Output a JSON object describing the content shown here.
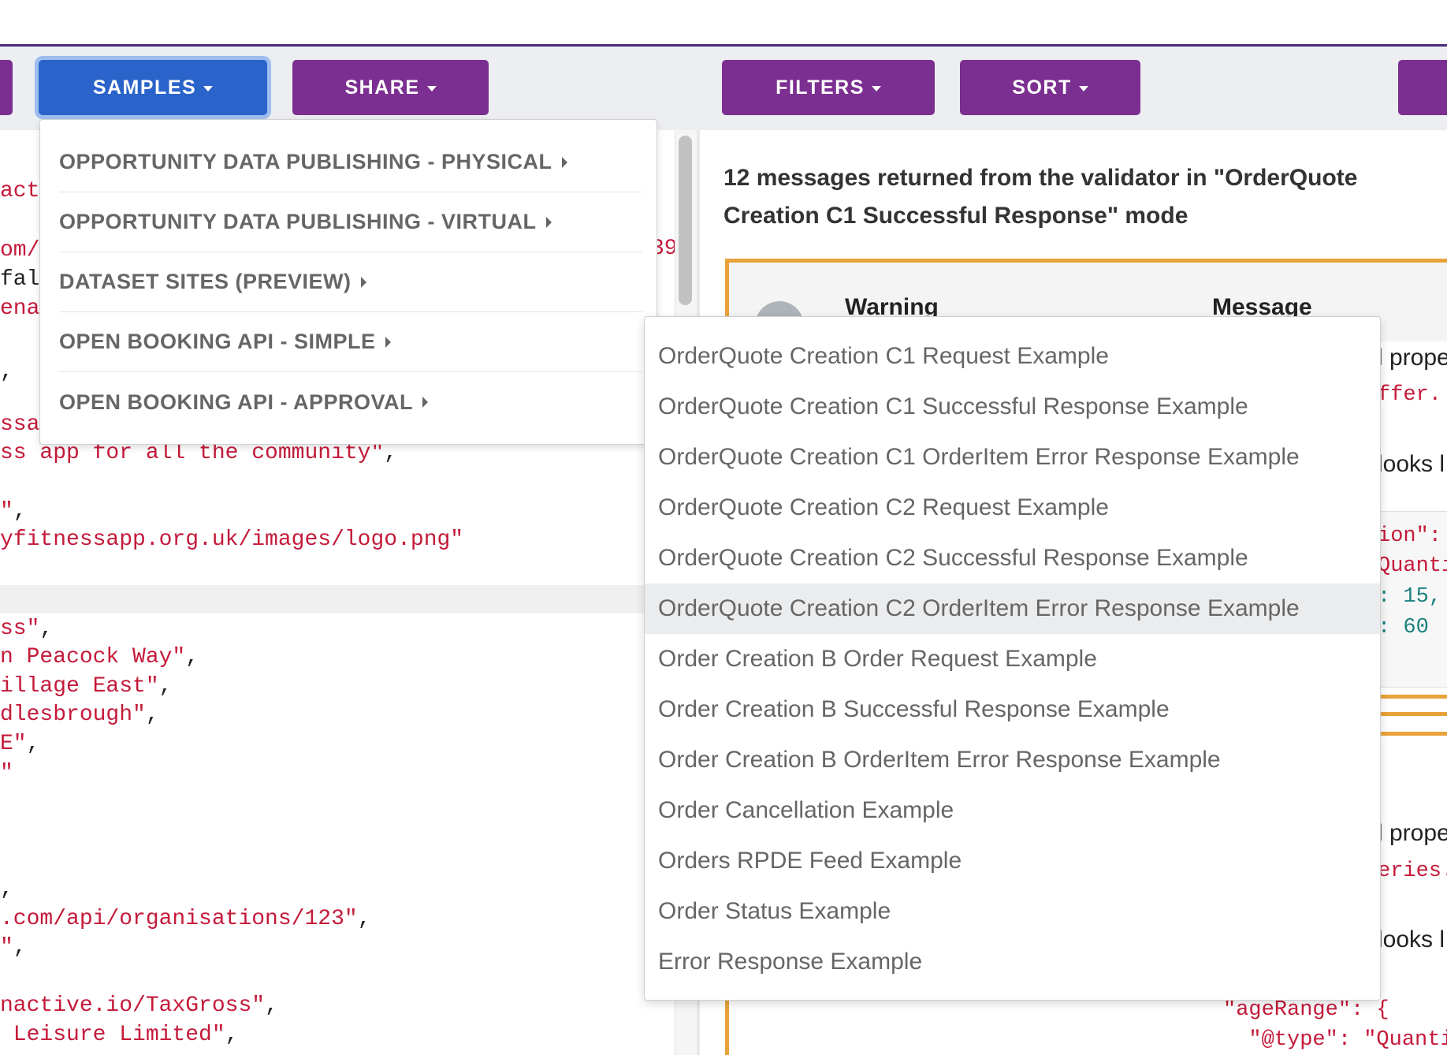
{
  "toolbar": {
    "buttons": [
      "SAMPLES",
      "SHARE",
      "FILTERS",
      "SORT"
    ]
  },
  "editor": {
    "lines": [
      {
        "t": "act",
        "p": ""
      },
      {
        "t": "om/",
        "p": ""
      },
      {
        "t": "",
        "p": "fals"
      },
      {
        "t": "enac",
        "p": ""
      },
      {
        "t": "",
        "p": ","
      },
      {
        "t": "ssap",
        "p": ""
      },
      {
        "t": "ss app for all the community\"",
        "p": ","
      },
      {
        "t": "\"",
        "p": ","
      },
      {
        "t": "yfitnessapp.org.uk/images/logo.png\"",
        "p": ""
      },
      {
        "t": "ss\"",
        "p": ","
      },
      {
        "t": "n Peacock Way\"",
        "p": ","
      },
      {
        "t": "illage East\"",
        "p": ","
      },
      {
        "t": "dlesbrough\"",
        "p": ","
      },
      {
        "t": "E\"",
        "p": ","
      },
      {
        "t": "\"",
        "p": ""
      },
      {
        "t": "",
        "p": ","
      },
      {
        "t": ".com/api/organisations/123\"",
        "p": ","
      },
      {
        "t": "\"",
        "p": ","
      },
      {
        "t": "nactive.io/TaxGross\"",
        "p": ","
      },
      {
        "t": " Leisure Limited\"",
        "p": ","
      }
    ],
    "stray_digit": "39"
  },
  "results": {
    "title": "12 messages returned from the validator in \"OrderQuote Creation C1 Successful Response\" mode",
    "col_warning": "Warning",
    "col_message": "Message",
    "msg1_prop": "l prope",
    "msg1_code": "ffer.",
    "msg1_looks": "looks l",
    "code1_a": "ion\":",
    "code1_b": "Quanti",
    "code1_c": ": 15,",
    "code1_d": ": 60",
    "msg2_prop": "l prope",
    "msg2_code": "eries.",
    "msg2_looks": "looks l",
    "code2_a": "\"ageRange\": {",
    "code2_b": "  \"@type\": \"Quanti"
  },
  "samples_menu": {
    "categories": [
      "OPPORTUNITY DATA PUBLISHING - PHYSICAL",
      "OPPORTUNITY DATA PUBLISHING - VIRTUAL",
      "DATASET SITES (PREVIEW)",
      "OPEN BOOKING API - SIMPLE",
      "OPEN BOOKING API - APPROVAL"
    ],
    "submenu": [
      "OrderQuote Creation C1 Request Example",
      "OrderQuote Creation C1 Successful Response Example",
      "OrderQuote Creation C1 OrderItem Error Response Example",
      "OrderQuote Creation C2 Request Example",
      "OrderQuote Creation C2 Successful Response Example",
      "OrderQuote Creation C2 OrderItem Error Response Example",
      "Order Creation B Order Request Example",
      "Order Creation B Successful Response Example",
      "Order Creation B OrderItem Error Response Example",
      "Order Cancellation Example",
      "Orders RPDE Feed Example",
      "Order Status Example",
      "Error Response Example"
    ],
    "hovered_index": 5
  },
  "colors": {
    "button_purple": "#7b2f90",
    "button_active_blue": "#2a63c9",
    "warning_orange": "#e9a23b",
    "code_red": "#c41a3a",
    "code_teal": "#1a7f7f"
  }
}
